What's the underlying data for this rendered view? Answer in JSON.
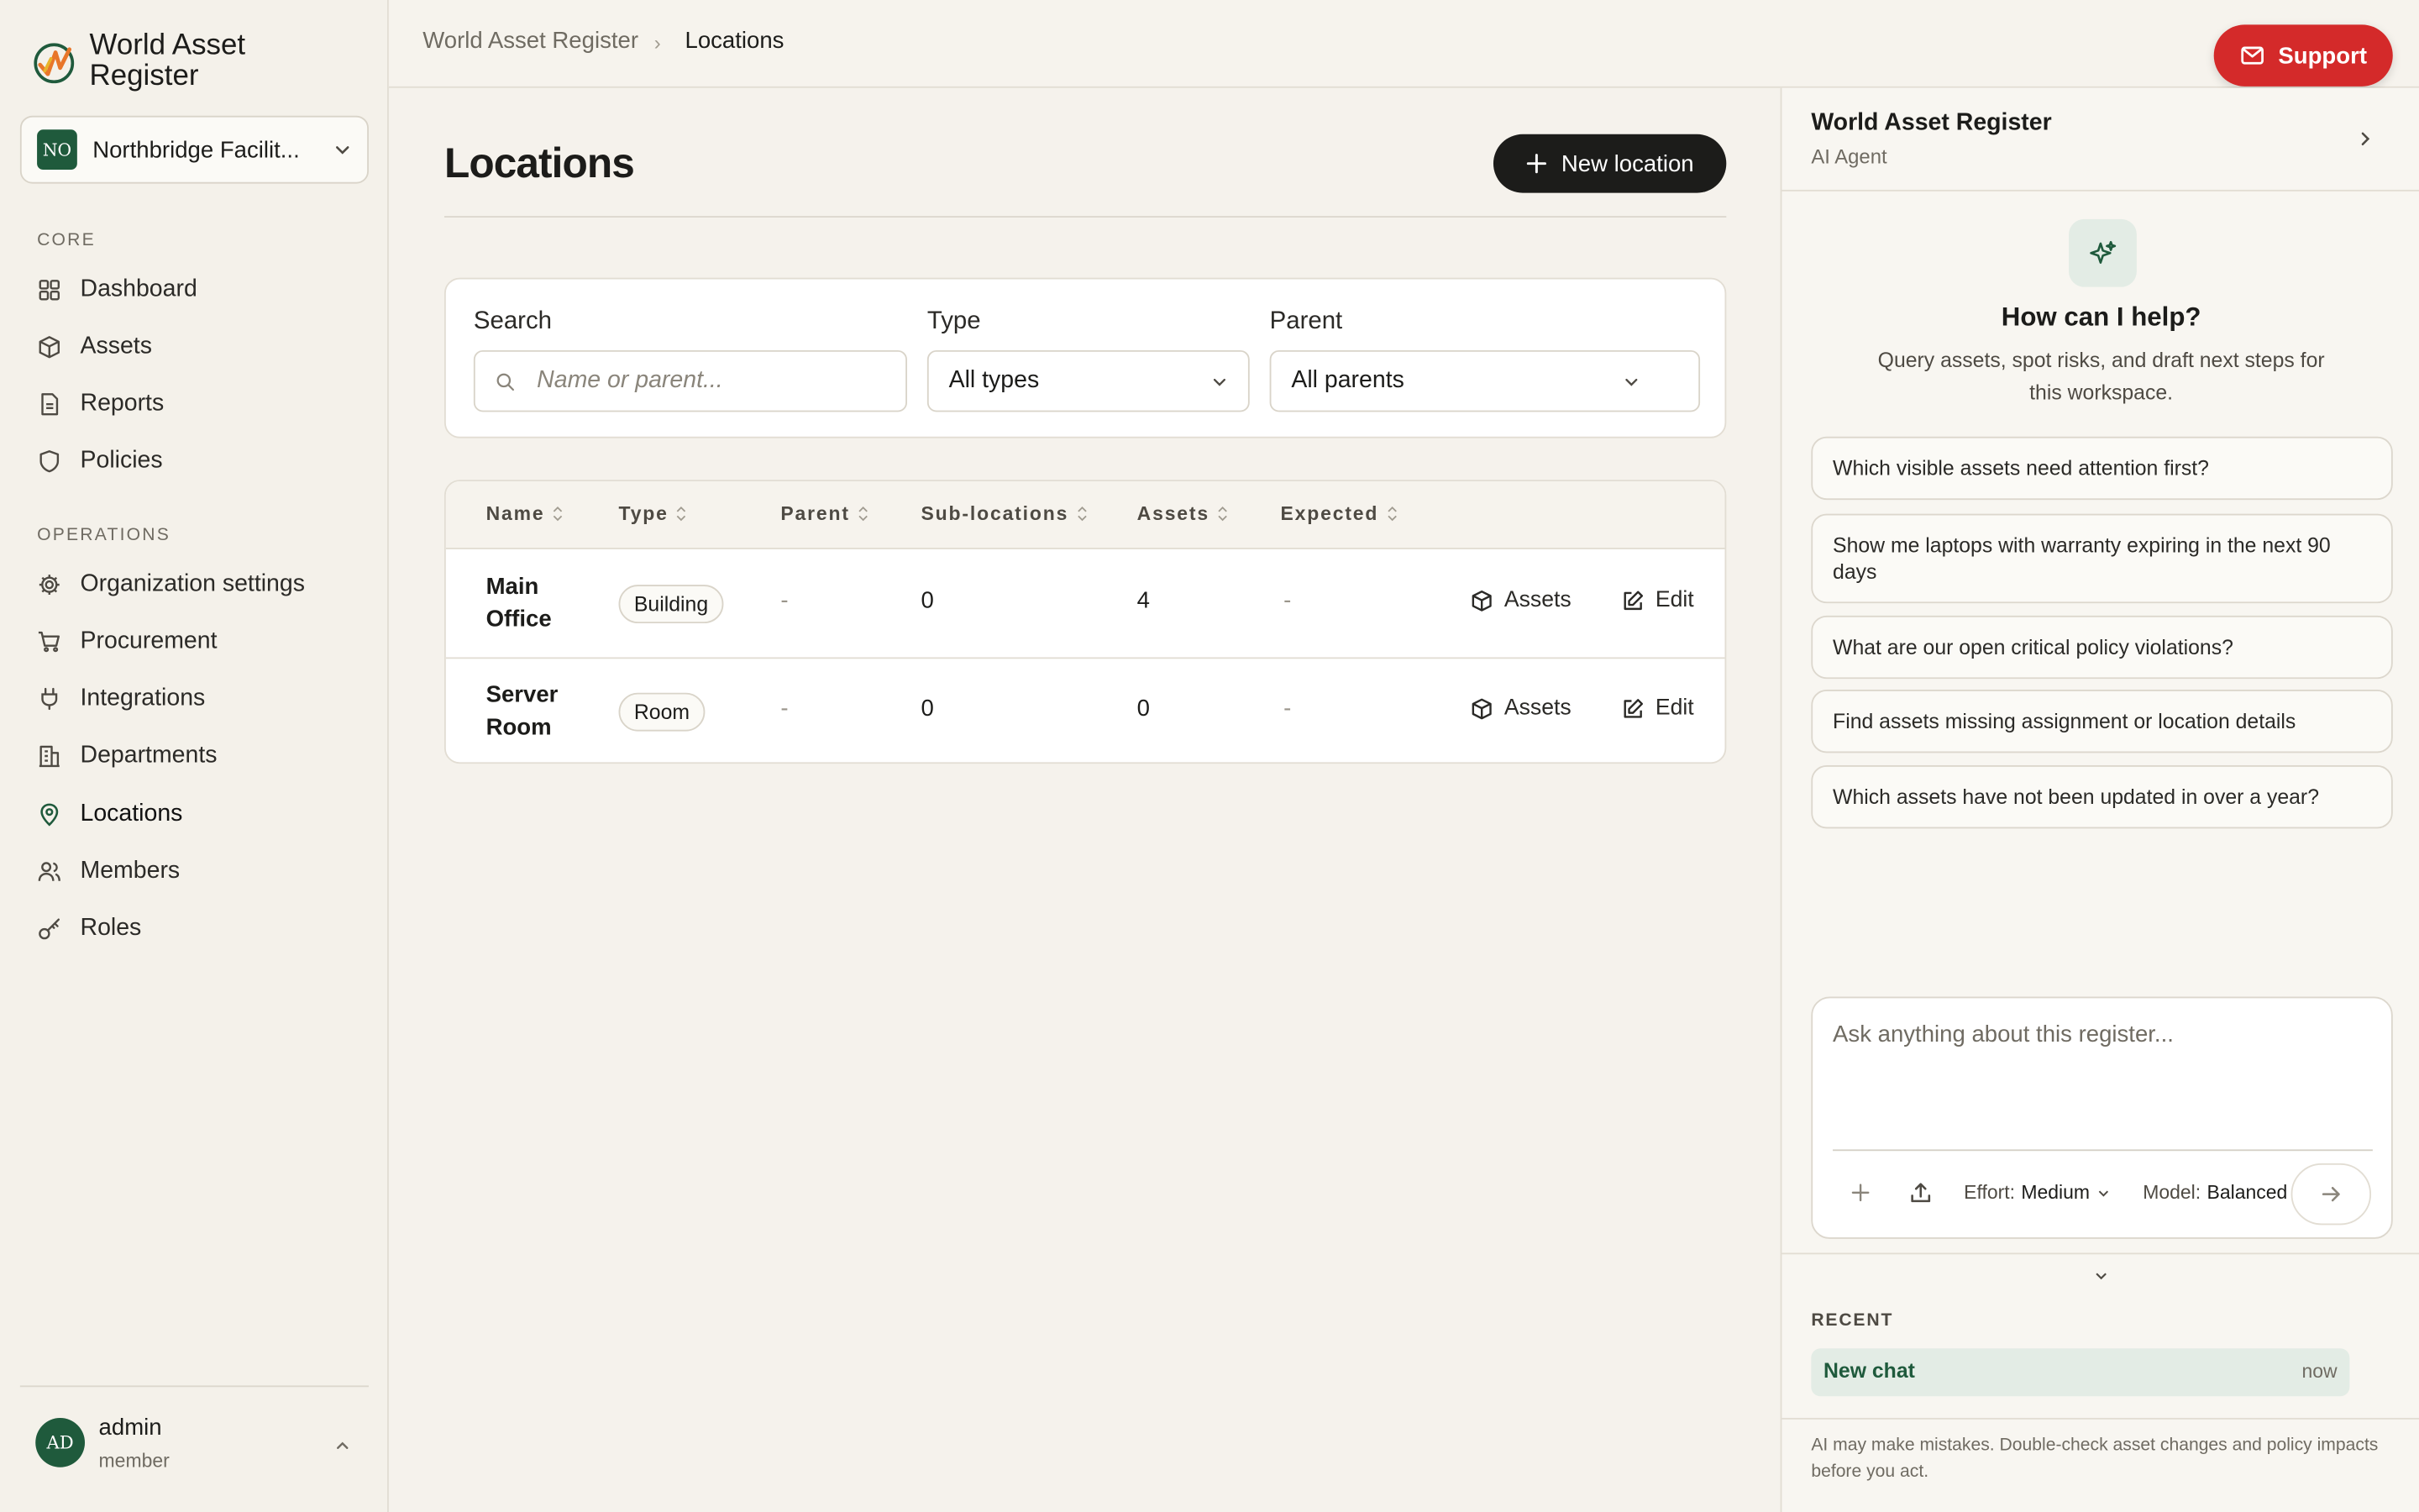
{
  "app": {
    "name": "World Asset Register"
  },
  "org": {
    "badge": "NO",
    "name": "Northbridge Facilit..."
  },
  "sidebar": {
    "core_label": "CORE",
    "core_items": [
      {
        "label": "Dashboard",
        "icon": "grid-icon"
      },
      {
        "label": "Assets",
        "icon": "box-icon"
      },
      {
        "label": "Reports",
        "icon": "file-icon"
      },
      {
        "label": "Policies",
        "icon": "shield-icon"
      }
    ],
    "ops_label": "OPERATIONS",
    "ops_items": [
      {
        "label": "Organization settings",
        "icon": "gear-icon"
      },
      {
        "label": "Procurement",
        "icon": "cart-icon"
      },
      {
        "label": "Integrations",
        "icon": "plug-icon"
      },
      {
        "label": "Departments",
        "icon": "building-icon"
      },
      {
        "label": "Locations",
        "icon": "map-pin-icon",
        "active": true
      },
      {
        "label": "Members",
        "icon": "users-icon"
      },
      {
        "label": "Roles",
        "icon": "key-icon"
      }
    ]
  },
  "user": {
    "initials": "AD",
    "name": "admin",
    "role": "member"
  },
  "breadcrumb": {
    "root": "World Asset Register",
    "separator": "›",
    "current": "Locations"
  },
  "support": {
    "label": "Support"
  },
  "page": {
    "title": "Locations",
    "new_button": "New location"
  },
  "filters": {
    "search_label": "Search",
    "search_placeholder": "Name or parent...",
    "type_label": "Type",
    "type_value": "All types",
    "parent_label": "Parent",
    "parent_value": "All parents"
  },
  "table": {
    "columns": [
      "Name",
      "Type",
      "Parent",
      "Sub-locations",
      "Assets",
      "Expected"
    ],
    "rows": [
      {
        "name": "Main Office",
        "type": "Building",
        "parent": "-",
        "sublocations": "0",
        "assets": "4",
        "expected": "-",
        "assets_link": "Assets",
        "edit_link": "Edit"
      },
      {
        "name": "Server Room",
        "type": "Room",
        "parent": "-",
        "sublocations": "0",
        "assets": "0",
        "expected": "-",
        "assets_link": "Assets",
        "edit_link": "Edit"
      }
    ]
  },
  "assistant": {
    "title": "World Asset Register",
    "subtitle": "AI Agent",
    "help_title": "How can I help?",
    "help_sub": "Query assets, spot risks, and draft next steps for this workspace.",
    "suggestions": [
      "Which visible assets need attention first?",
      "Show me laptops with warranty expiring in the next 90 days",
      "What are our open critical policy violations?",
      "Find assets missing assignment or location details",
      "Which assets have not been updated in over a year?"
    ],
    "composer_placeholder": "Ask anything about this register...",
    "effort_label": "Effort:",
    "effort_value": "Medium",
    "model_label": "Model:",
    "model_value": "Balanced",
    "recent_label": "RECENT",
    "recent_items": [
      {
        "name": "New chat",
        "time": "now"
      }
    ],
    "disclaimer": "AI may make mistakes. Double-check asset changes and policy impacts before you act."
  },
  "colors": {
    "brand_green": "#1f5a3c",
    "support_red": "#d42a2a",
    "accent_dark": "#1c1c1a"
  }
}
